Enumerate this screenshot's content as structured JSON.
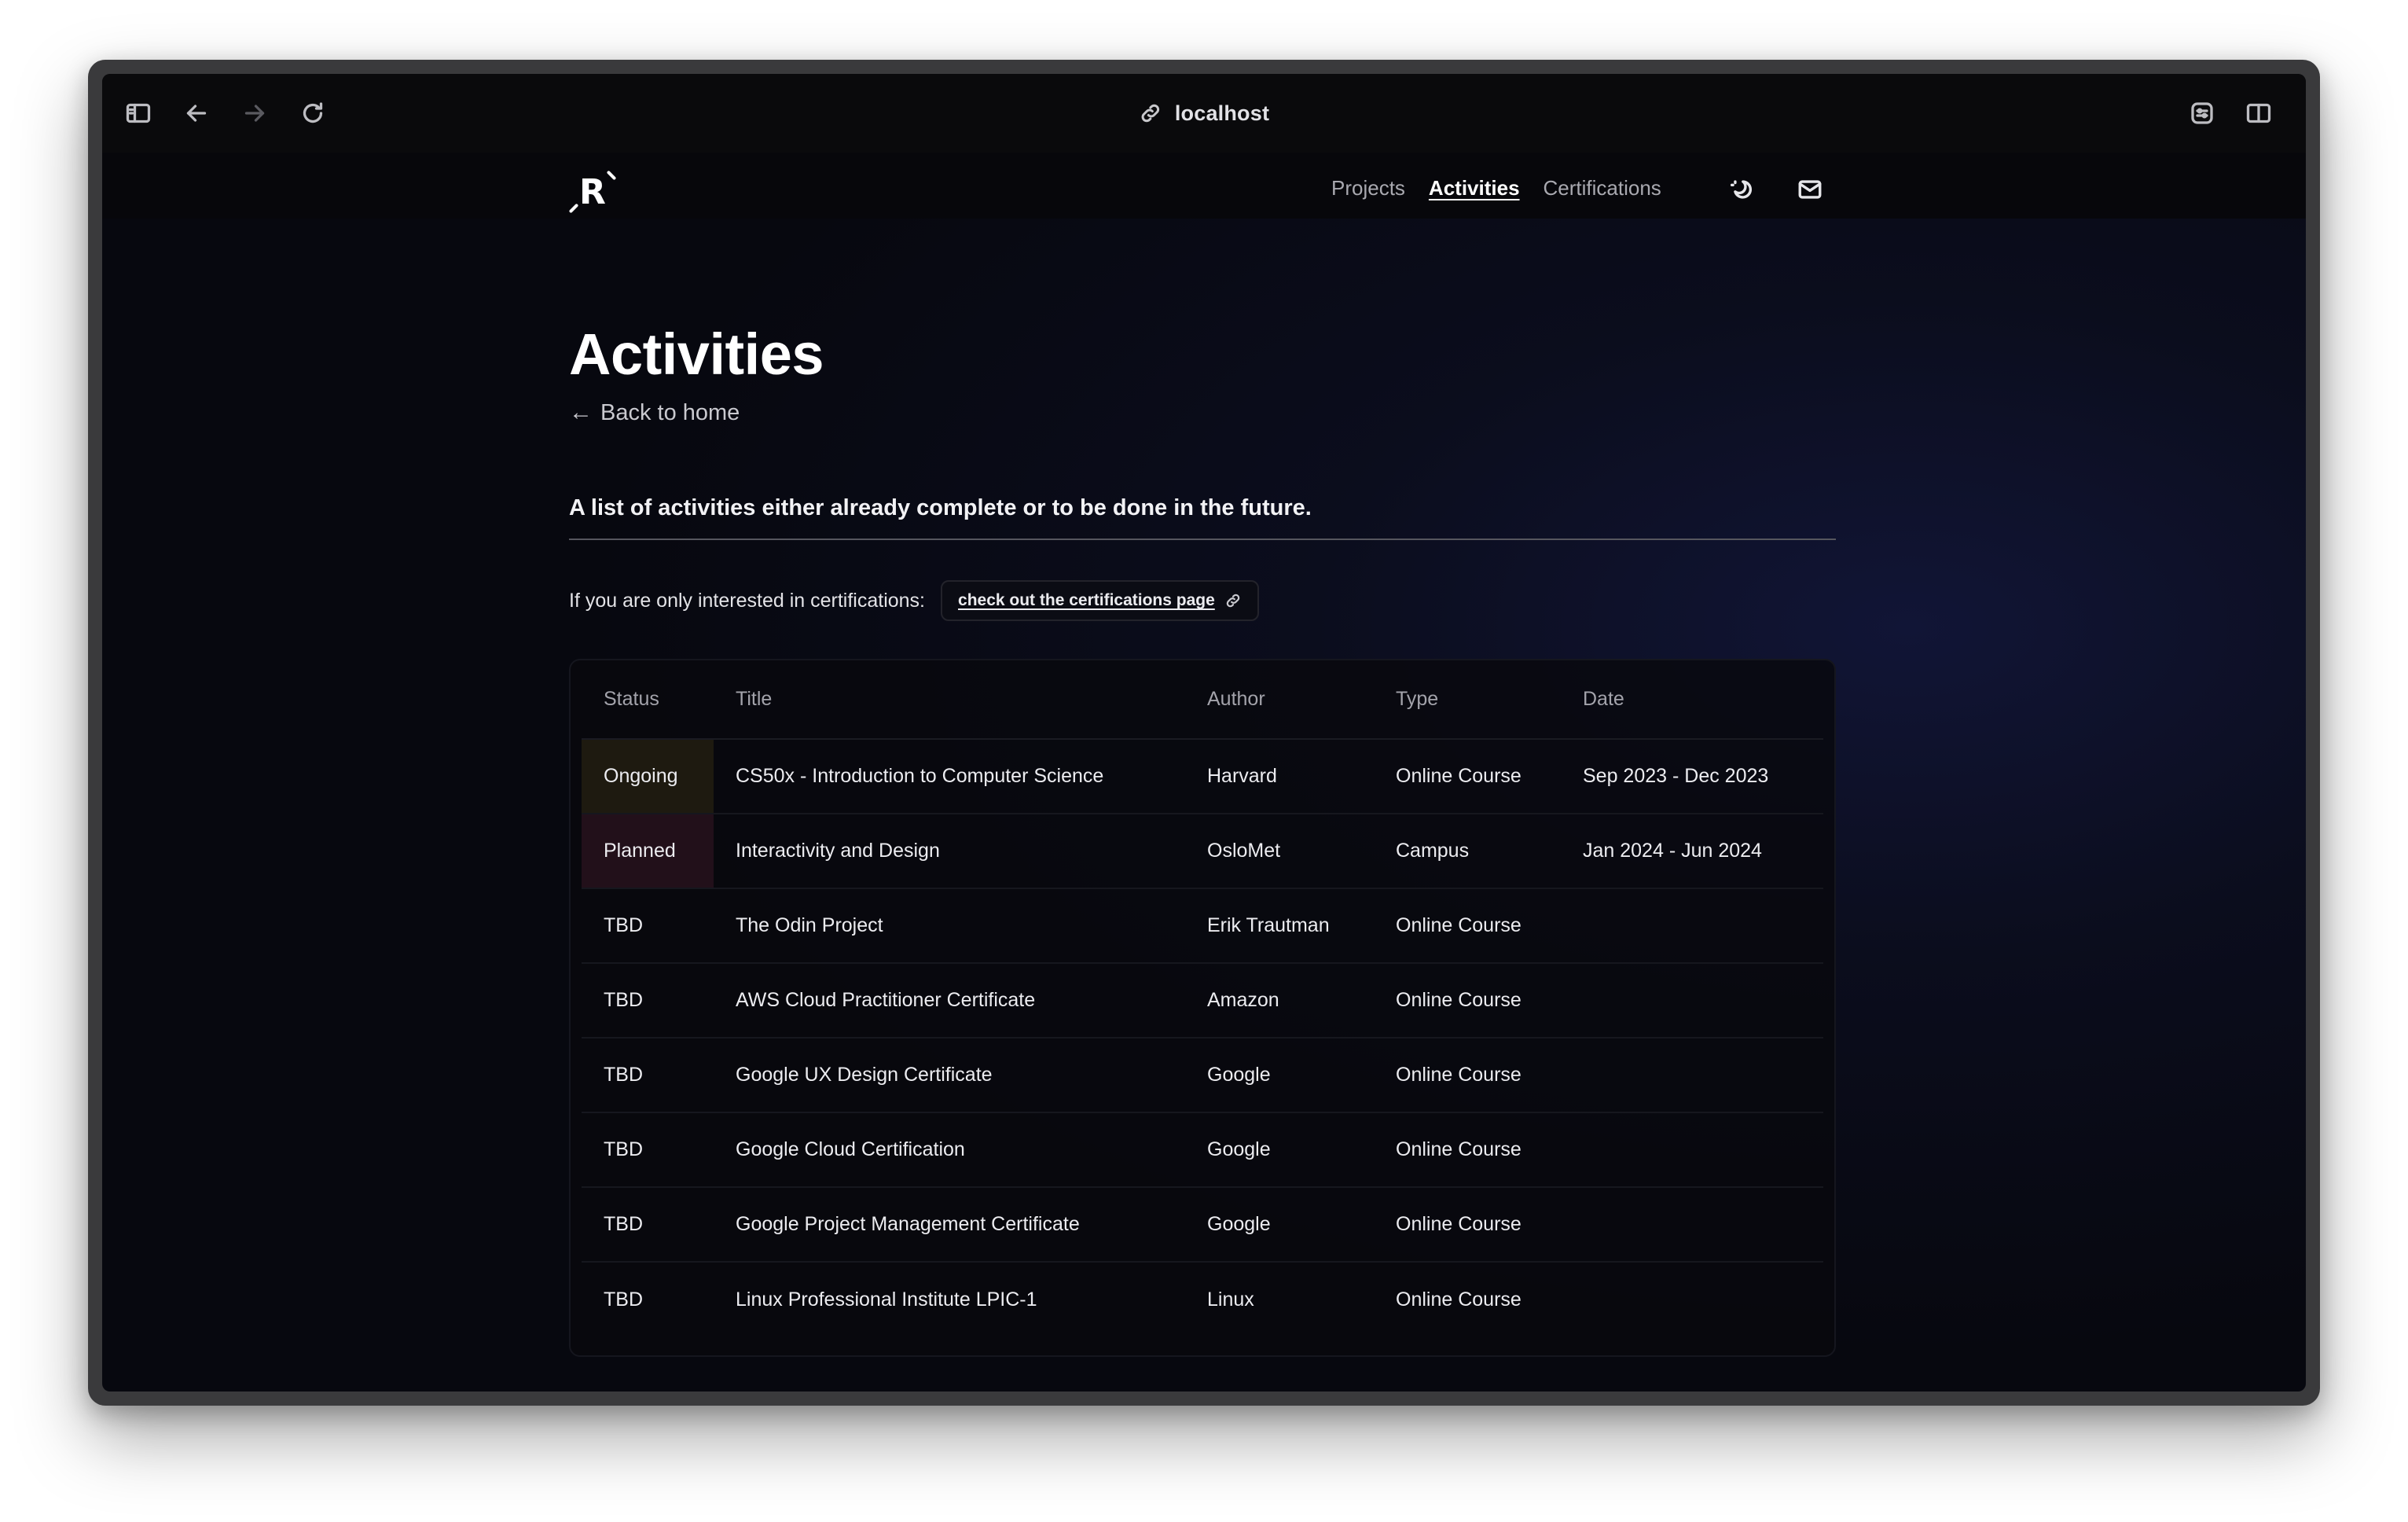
{
  "browser": {
    "address": "localhost",
    "icons": [
      "sidebar-icon",
      "back-arrow-icon",
      "forward-arrow-icon",
      "reload-icon",
      "link-icon",
      "extension-icon",
      "split-view-icon"
    ]
  },
  "site": {
    "logo_letter": "R",
    "nav": [
      {
        "label": "Projects",
        "active": false
      },
      {
        "label": "Activities",
        "active": true
      },
      {
        "label": "Certifications",
        "active": false
      }
    ],
    "icons": [
      "theme-toggle-icon",
      "mail-icon"
    ]
  },
  "page": {
    "title": "Activities",
    "back_link": "Back to home",
    "lead": "A list of activities either already complete or to be done in the future.",
    "cert_prompt": "If you are only interested in certifications:",
    "cert_link": "check out the certifications page"
  },
  "table": {
    "headers": [
      "Status",
      "Title",
      "Author",
      "Type",
      "Date"
    ],
    "rows": [
      {
        "status": "Ongoing",
        "title": "CS50x - Introduction to Computer Science",
        "author": "Harvard",
        "type": "Online Course",
        "date": "Sep 2023 - Dec 2023"
      },
      {
        "status": "Planned",
        "title": "Interactivity and Design",
        "author": "OsloMet",
        "type": "Campus",
        "date": "Jan 2024 - Jun 2024"
      },
      {
        "status": "TBD",
        "title": "The Odin Project",
        "author": "Erik Trautman",
        "type": "Online Course",
        "date": ""
      },
      {
        "status": "TBD",
        "title": "AWS Cloud Practitioner Certificate",
        "author": "Amazon",
        "type": "Online Course",
        "date": ""
      },
      {
        "status": "TBD",
        "title": "Google UX Design Certificate",
        "author": "Google",
        "type": "Online Course",
        "date": ""
      },
      {
        "status": "TBD",
        "title": "Google Cloud Certification",
        "author": "Google",
        "type": "Online Course",
        "date": ""
      },
      {
        "status": "TBD",
        "title": "Google Project Management Certificate",
        "author": "Google",
        "type": "Online Course",
        "date": ""
      },
      {
        "status": "TBD",
        "title": "Linux Professional Institute LPIC-1",
        "author": "Linux",
        "type": "Online Course",
        "date": ""
      }
    ]
  },
  "colors": {
    "ongoing_bg": "#1e1a10",
    "planned_bg": "#22101a",
    "background": "#07080f"
  }
}
